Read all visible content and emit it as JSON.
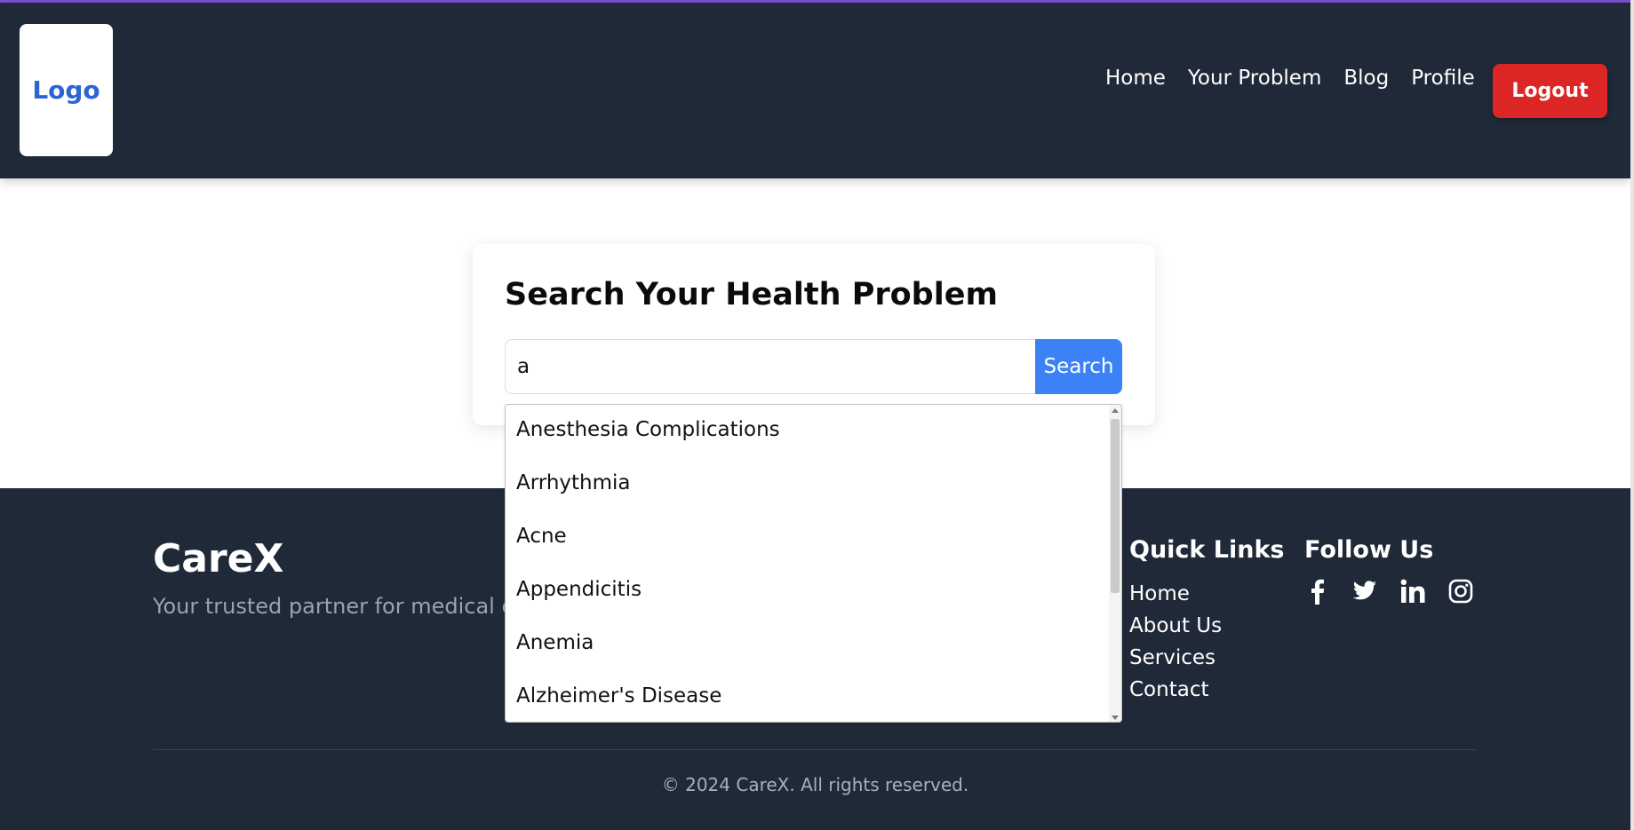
{
  "header": {
    "logo": "Logo",
    "nav": [
      "Home",
      "Your Problem",
      "Blog",
      "Profile"
    ],
    "logout_label": "Logout"
  },
  "search": {
    "title": "Search Your Health Problem",
    "value": "a",
    "button_label": "Search"
  },
  "suggestions": [
    "Anesthesia Complications",
    "Arrhythmia",
    "Acne",
    "Appendicitis",
    "Anemia",
    "Alzheimer's Disease"
  ],
  "footer": {
    "brand": "CareX",
    "tagline": "Your trusted partner for medical con",
    "quick_links_title": "Quick Links",
    "quick_links": [
      "Home",
      "About Us",
      "Services",
      "Contact"
    ],
    "follow_title": "Follow Us",
    "social_icons": [
      "facebook-icon",
      "twitter-icon",
      "linkedin-icon",
      "instagram-icon"
    ],
    "copyright": "© 2024 CareX. All rights reserved."
  },
  "colors": {
    "header_bg": "#202938",
    "accent_blue": "#3b82f6",
    "logout_red": "#dc2626",
    "logo_blue": "#2c63d6"
  }
}
